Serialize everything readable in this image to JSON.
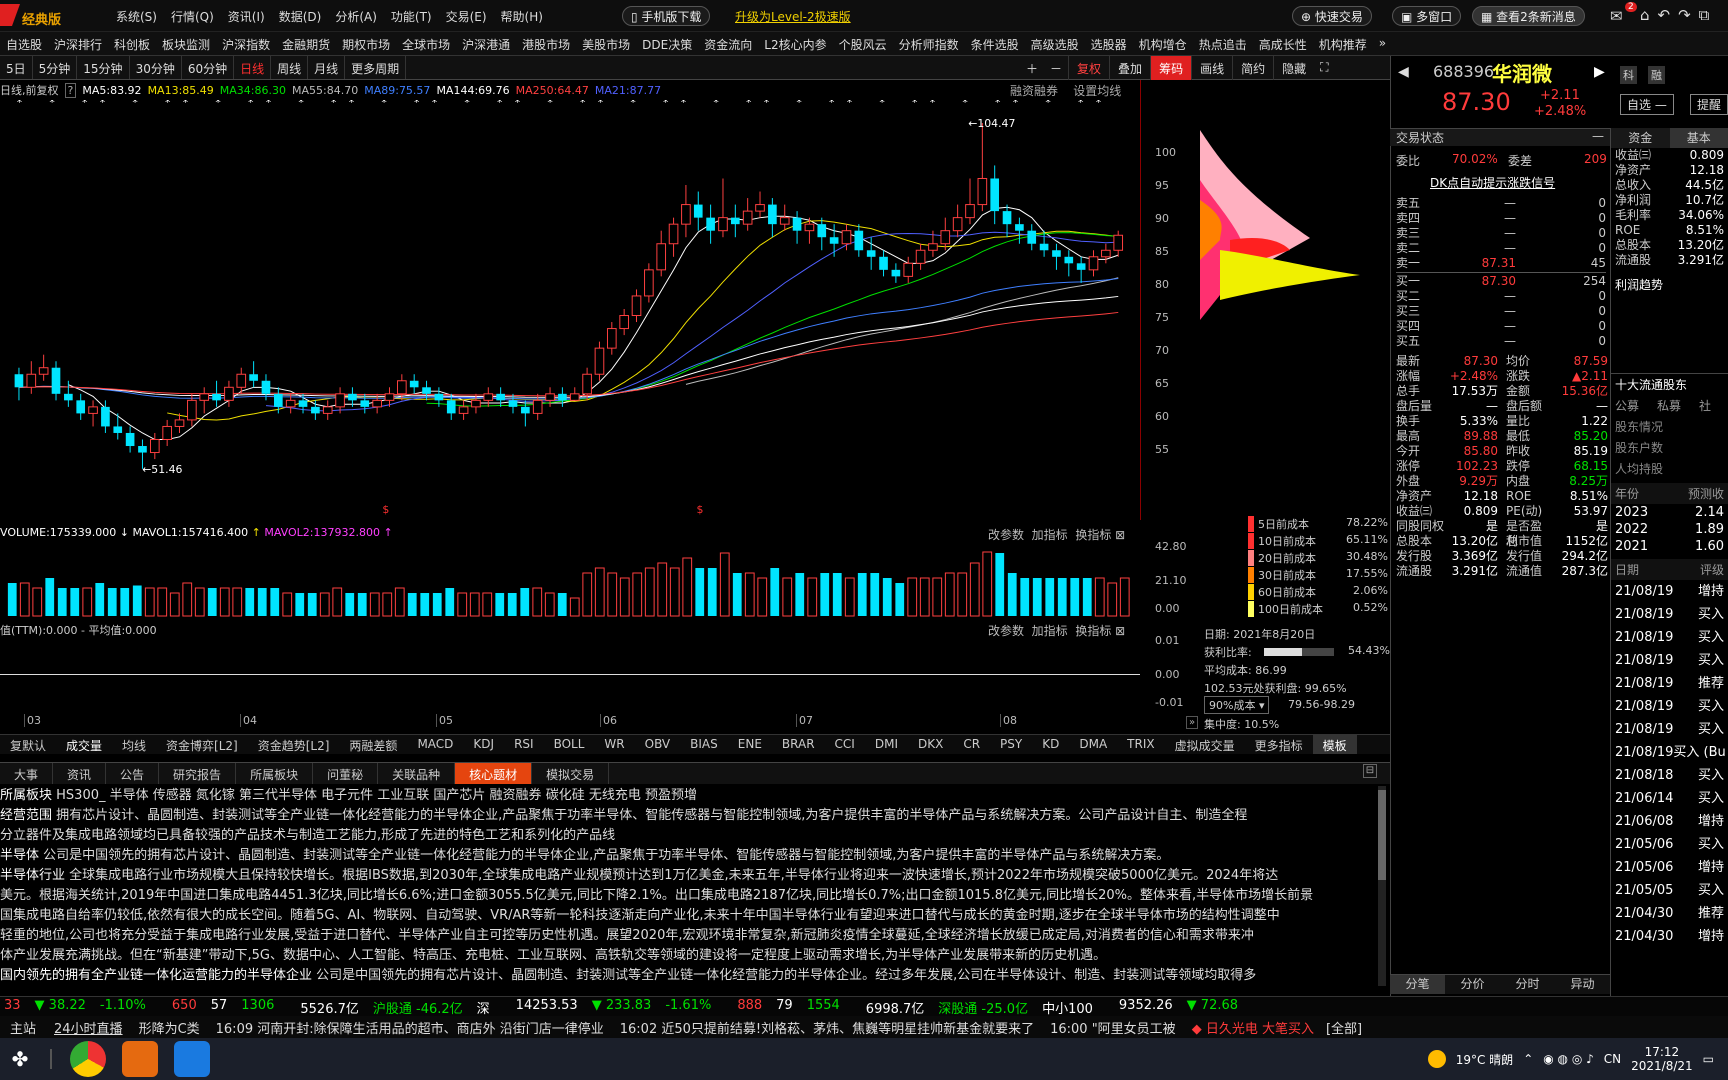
{
  "app": {
    "name": "经典版",
    "menu": [
      "系统(S)",
      "行情(Q)",
      "资讯(I)",
      "数据(D)",
      "分析(A)",
      "功能(T)",
      "交易(E)",
      "帮助(H)"
    ],
    "mobile_download": "手机版下载",
    "upgrade": "升级为Level-2极速版",
    "quick_trade": "快速交易",
    "multi_window": "多窗口",
    "news_alert": "查看2条新消息",
    "mail_badge": "2"
  },
  "nav": [
    "自选股",
    "沪深排行",
    "科创板",
    "板块监测",
    "沪深指数",
    "金融期货",
    "期权市场",
    "全球市场",
    "沪深港通",
    "港股市场",
    "美股市场",
    "DDE决策",
    "资金流向",
    "L2核心内参",
    "个股风云",
    "分析师指数",
    "条件选股",
    "高级选股",
    "选股器",
    "机构增仓",
    "热点追击",
    "高成长性",
    "机构推荐"
  ],
  "toolbar": {
    "periods": [
      "5日",
      "5分钟",
      "15分钟",
      "30分钟",
      "60分钟",
      "日线",
      "周线",
      "月线",
      "更多周期"
    ],
    "selected": "日线",
    "tools": [
      "复权",
      "叠加",
      "筹码",
      "画线",
      "简约",
      "隐藏"
    ]
  },
  "ma_legend": {
    "prefix": "日线,前复权",
    "items": [
      {
        "label": "MA5:83.92",
        "color": "#ffffff"
      },
      {
        "label": "MA13:85.49",
        "color": "#f0e000"
      },
      {
        "label": "MA34:86.30",
        "color": "#00e000"
      },
      {
        "label": "MA55:84.70",
        "color": "#bbbbbb"
      },
      {
        "label": "MA89:75.57",
        "color": "#3f7fff"
      },
      {
        "label": "MA144:69.76",
        "color": "#ffffff"
      },
      {
        "label": "MA250:64.47",
        "color": "#ff4040"
      },
      {
        "label": "MA21:87.77",
        "color": "#5060ff"
      }
    ],
    "right": [
      "融资融券",
      "设置均线"
    ]
  },
  "chart_data": {
    "type": "candlestick",
    "title": "688396 华润微 日线",
    "ylim": [
      52,
      105
    ],
    "y_ticks": [
      100,
      95,
      90,
      85,
      80,
      75,
      70,
      65,
      60,
      55
    ],
    "x_ticks": [
      "03",
      "04",
      "05",
      "06",
      "07",
      "08"
    ],
    "annotations": [
      {
        "label": "104.47"
      },
      {
        "label": "51.46"
      },
      {
        "label": "$"
      },
      {
        "label": "$"
      }
    ],
    "candles": [
      [
        66,
        64,
        67,
        62
      ],
      [
        64,
        66,
        68,
        63
      ],
      [
        66,
        67,
        69,
        65
      ],
      [
        67,
        63,
        68,
        62
      ],
      [
        63,
        62,
        65,
        61
      ],
      [
        62,
        60,
        63,
        59
      ],
      [
        60,
        61,
        62,
        58
      ],
      [
        61,
        58,
        62,
        57
      ],
      [
        58,
        57,
        60,
        56
      ],
      [
        57,
        55,
        58,
        54
      ],
      [
        55,
        54,
        56,
        51.5
      ],
      [
        54,
        56,
        57,
        53
      ],
      [
        56,
        58,
        59,
        55
      ],
      [
        58,
        59,
        60,
        57
      ],
      [
        59,
        62,
        63,
        58
      ],
      [
        62,
        63,
        64,
        60
      ],
      [
        63,
        62,
        65,
        61
      ],
      [
        62,
        64,
        65,
        61
      ],
      [
        64,
        66,
        67,
        63
      ],
      [
        66,
        65,
        68,
        64
      ],
      [
        65,
        63,
        66,
        62
      ],
      [
        63,
        61,
        64,
        60
      ],
      [
        61,
        62,
        63,
        60
      ],
      [
        62,
        61,
        63,
        60
      ],
      [
        61,
        60,
        62,
        59
      ],
      [
        60,
        61,
        62,
        59
      ],
      [
        61,
        63,
        64,
        60
      ],
      [
        63,
        62,
        64,
        61
      ],
      [
        62,
        61,
        63,
        60
      ],
      [
        61,
        62,
        63,
        60
      ],
      [
        62,
        63,
        64,
        61
      ],
      [
        63,
        65,
        66,
        62
      ],
      [
        65,
        64,
        66,
        63
      ],
      [
        64,
        63,
        65,
        62
      ],
      [
        63,
        62,
        64,
        61
      ],
      [
        62,
        60,
        63,
        59
      ],
      [
        60,
        61,
        62,
        59
      ],
      [
        61,
        62,
        63,
        60
      ],
      [
        62,
        63,
        64,
        61
      ],
      [
        63,
        62,
        64,
        61
      ],
      [
        62,
        61,
        63,
        60
      ],
      [
        61,
        60,
        62,
        58
      ],
      [
        60,
        62,
        63,
        59
      ],
      [
        62,
        63,
        64,
        61
      ],
      [
        63,
        62,
        64,
        61
      ],
      [
        62,
        63,
        64,
        62
      ],
      [
        63,
        66,
        67,
        62
      ],
      [
        66,
        70,
        71,
        65
      ],
      [
        70,
        73,
        74,
        69
      ],
      [
        73,
        75,
        76,
        72
      ],
      [
        75,
        78,
        79,
        74
      ],
      [
        78,
        82,
        83,
        77
      ],
      [
        82,
        86,
        88,
        81
      ],
      [
        86,
        89,
        90,
        84
      ],
      [
        89,
        92,
        95,
        87
      ],
      [
        92,
        90,
        94,
        88
      ],
      [
        90,
        88,
        92,
        86
      ],
      [
        88,
        90,
        96,
        87
      ],
      [
        90,
        89,
        92,
        87
      ],
      [
        89,
        91,
        93,
        88
      ],
      [
        91,
        92,
        94,
        90
      ],
      [
        92,
        89,
        93,
        87
      ],
      [
        89,
        90,
        92,
        88
      ],
      [
        90,
        88,
        91,
        86
      ],
      [
        88,
        89,
        90,
        86
      ],
      [
        89,
        87,
        90,
        85
      ],
      [
        87,
        86,
        89,
        84
      ],
      [
        86,
        88,
        89,
        85
      ],
      [
        88,
        85,
        89,
        84
      ],
      [
        85,
        84,
        87,
        82
      ],
      [
        84,
        82,
        85,
        81
      ],
      [
        82,
        81,
        83,
        80
      ],
      [
        81,
        83,
        84,
        80
      ],
      [
        83,
        85,
        86,
        82
      ],
      [
        85,
        86,
        88,
        84
      ],
      [
        86,
        88,
        90,
        85
      ],
      [
        88,
        90,
        92,
        87
      ],
      [
        90,
        92,
        96,
        89
      ],
      [
        92,
        96,
        104.5,
        91
      ],
      [
        96,
        91,
        98,
        89
      ],
      [
        91,
        89,
        92,
        87
      ],
      [
        89,
        88,
        90,
        86
      ],
      [
        88,
        86,
        89,
        85
      ],
      [
        86,
        85,
        88,
        84
      ],
      [
        85,
        84,
        86,
        82
      ],
      [
        84,
        83,
        85,
        81
      ],
      [
        83,
        82,
        84,
        80
      ],
      [
        82,
        84,
        85,
        81
      ],
      [
        84,
        85,
        86,
        83
      ],
      [
        85,
        87.3,
        88,
        84
      ]
    ]
  },
  "volume": {
    "label": "VOLUME:175339.000",
    "mavol1": "MAVOL1:157416.400",
    "mavol2": "MAVOL2:137932.800",
    "ticks": [
      "42.80",
      "21.10",
      "0.00"
    ],
    "tools": [
      "改参数",
      "加指标",
      "换指标"
    ]
  },
  "ttm": {
    "label": "值(TTM):0.000 - 平均值:0.000",
    "ticks": [
      "0.01",
      "0.00",
      "-0.01"
    ],
    "tools": [
      "改参数",
      "加指标",
      "换指标"
    ]
  },
  "chips": {
    "rows": [
      {
        "label": "5日前成本",
        "value": "78.22%",
        "color": "#ff3030"
      },
      {
        "label": "10日前成本",
        "value": "65.11%",
        "color": "#ff3030"
      },
      {
        "label": "20日前成本",
        "value": "30.48%",
        "color": "#ff8080"
      },
      {
        "label": "30日前成本",
        "value": "17.55%",
        "color": "#ff8000"
      },
      {
        "label": "60日前成本",
        "value": "2.06%",
        "color": "#ffd000"
      },
      {
        "label": "100日前成本",
        "value": "0.52%",
        "color": "#ffff60"
      }
    ],
    "date": "日期: 2021年8月20日",
    "profit_label": "获利比率:",
    "profit": "54.43%",
    "avg_cost": "平均成本: 86.99",
    "profit_cost": "102.53元处获利盘: 99.65%",
    "cost90": "90%成本",
    "cost90_range": "79.56-98.29",
    "concentration": "集中度: 10.5%"
  },
  "indicators": [
    "复默认",
    "成交量",
    "均线",
    "资金博弈[L2]",
    "资金趋势[L2]",
    "两融差额",
    "MACD",
    "KDJ",
    "RSI",
    "BOLL",
    "WR",
    "OBV",
    "BIAS",
    "ENE",
    "BRAR",
    "CCI",
    "DMI",
    "DKX",
    "CR",
    "PSY",
    "KD",
    "DMA",
    "TRIX",
    "虚拟成交量",
    "更多指标",
    "模板"
  ],
  "tabs": [
    "大事",
    "资讯",
    "公告",
    "研究报告",
    "所属板块",
    "问董秘",
    "关联品种",
    "核心题材",
    "模拟交易"
  ],
  "tab_selected": "核心题材",
  "content": [
    {
      "head": "所属板块",
      "text": "HS300_ 半导体 传感器 氮化镓 第三代半导体 电子元件 工业互联 国产芯片 融资融券 碳化硅 无线充电 预盈预增"
    },
    {
      "head": "经营范围",
      "text": "拥有芯片设计、晶圆制造、封装测试等全产业链一体化经营能力的半导体企业,产品聚焦于功率半导体、智能传感器与智能控制领域,为客户提供丰富的半导体产品与系统解决方案。公司产品设计自主、制造全程"
    },
    {
      "head": "",
      "text": "分立器件及集成电路领域均已具备较强的产品技术与制造工艺能力,形成了先进的特色工艺和系列化的产品线"
    },
    {
      "head": "半导体",
      "text": "公司是中国领先的拥有芯片设计、晶圆制造、封装测试等全产业链一体化经营能力的半导体企业,产品聚焦于功率半导体、智能传感器与智能控制领域,为客户提供丰富的半导体产品与系统解决方案。"
    },
    {
      "head": "半导体行业",
      "text": "全球集成电路行业市场规模大且保持较快增长。根据IBS数据,到2030年,全球集成电路产业规模预计达到1万亿美金,未来五年,半导体行业将迎来一波快速增长,预计2022年市场规模突破5000亿美元。2024年将达"
    },
    {
      "head": "",
      "text": "美元。根据海关统计,2019年中国进口集成电路4451.3亿块,同比增长6.6%;进口金额3055.5亿美元,同比下降2.1%。出口集成电路2187亿块,同比增长0.7%;出口金额1015.8亿美元,同比增长20%。整体来看,半导体市场增长前景"
    },
    {
      "head": "",
      "text": "国集成电路自给率仍较低,依然有很大的成长空间。随着5G、AI、物联网、自动驾驶、VR/AR等新一轮科技逐渐走向产业化,未来十年中国半导体行业有望迎来进口替代与成长的黄金时期,逐步在全球半导体市场的结构性调整中"
    },
    {
      "head": "",
      "text": "轻重的地位,公司也将充分受益于集成电路行业发展,受益于进口替代、半导体产业自主可控等历史性机遇。展望2020年,宏观环境非常复杂,新冠肺炎疫情全球蔓延,全球经济增长放缓已成定局,对消费者的信心和需求带来冲"
    },
    {
      "head": "",
      "text": "体产业发展充满挑战。但在“新基建”带动下,5G、数据中心、人工智能、特高压、充电桩、工业互联网、高铁轨交等领域的建设将一定程度上驱动需求增长,为半导体产业发展带来新的历史机遇。"
    },
    {
      "head": "国内领先的拥有全产业链一体化运营能力的半导体企业",
      "text": "公司是中国领先的拥有芯片设计、晶圆制造、封装测试等全产业链一体化经营能力的半导体企业。经过多年发展,公司在半导体设计、制造、封装测试等领域均取得多"
    }
  ],
  "quote": {
    "code": "688396",
    "name": "华润微",
    "price": "87.30",
    "change": "+2.11",
    "pct": "+2.48%",
    "btn_watch": "自选",
    "btn_alert": "提醒",
    "tags": [
      "科",
      "融"
    ]
  },
  "trade_status": {
    "label": "交易状态",
    "wb_label": "委比",
    "wb": "70.02%",
    "wc_label": "委差",
    "wc": "209",
    "dk": "DK点自动提示涨跌信号"
  },
  "orderbook": {
    "sell": [
      [
        "卖五",
        "—",
        "0"
      ],
      [
        "卖四",
        "—",
        "0"
      ],
      [
        "卖三",
        "—",
        "0"
      ],
      [
        "卖二",
        "—",
        "0"
      ],
      [
        "卖一",
        "87.31",
        "45"
      ]
    ],
    "buy": [
      [
        "买一",
        "87.30",
        "254"
      ],
      [
        "买二",
        "—",
        "0"
      ],
      [
        "买三",
        "—",
        "0"
      ],
      [
        "买四",
        "—",
        "0"
      ],
      [
        "买五",
        "—",
        "0"
      ]
    ]
  },
  "stats": [
    [
      "最新",
      "87.30",
      "均价",
      "87.59"
    ],
    [
      "涨幅",
      "+2.48%",
      "涨跌",
      "▲2.11"
    ],
    [
      "总手",
      "17.53万",
      "金额",
      "15.36亿"
    ],
    [
      "盘后量",
      "—",
      "盘后额",
      "—"
    ],
    [
      "换手",
      "5.33%",
      "量比",
      "1.22"
    ],
    [
      "最高",
      "89.88",
      "最低",
      "85.20"
    ],
    [
      "今开",
      "85.80",
      "昨收",
      "85.19"
    ],
    [
      "涨停",
      "102.23",
      "跌停",
      "68.15"
    ],
    [
      "外盘",
      "9.29万",
      "内盘",
      "8.25万"
    ],
    [
      "净资产",
      "12.18",
      "ROE",
      "8.51%"
    ],
    [
      "收益㈢",
      "0.809",
      "PE(动)",
      "53.97"
    ],
    [
      "同股同权",
      "是",
      "是否盈利",
      "是"
    ],
    [
      "总股本",
      "13.20亿",
      "总市值",
      "1152亿"
    ],
    [
      "发行股",
      "3.369亿",
      "发行值",
      "294.2亿"
    ],
    [
      "流通股",
      "3.291亿",
      "流通值",
      "287.3亿"
    ]
  ],
  "bottom_tabs": [
    "分笔",
    "分价",
    "分时",
    "异动"
  ],
  "fin": {
    "tabs": [
      "资金",
      "基本"
    ],
    "rows": [
      [
        "收益㈢",
        "0.809"
      ],
      [
        "净资产",
        "12.18"
      ],
      [
        "总收入",
        "44.5亿"
      ],
      [
        "净利润",
        "10.7亿"
      ],
      [
        "毛利率",
        "34.06%"
      ],
      [
        "ROE",
        "8.51%"
      ],
      [
        "总股本",
        "13.20亿"
      ],
      [
        "流通股",
        "3.291亿"
      ]
    ],
    "trend": "利润趋势",
    "holders": "十大流通股东",
    "holder_tabs": [
      "公募",
      "私募",
      "社"
    ],
    "links": [
      "股东情况",
      "股东户数",
      "人均持股"
    ],
    "year_head": [
      "年份",
      "预测收"
    ],
    "years": [
      [
        "2023",
        "2.14"
      ],
      [
        "2022",
        "1.89"
      ],
      [
        "2021",
        "1.60"
      ]
    ],
    "date_head": [
      "日期",
      "评级"
    ],
    "ratings": [
      [
        "21/08/19",
        "增持"
      ],
      [
        "21/08/19",
        "买入"
      ],
      [
        "21/08/19",
        "买入"
      ],
      [
        "21/08/19",
        "买入"
      ],
      [
        "21/08/19",
        "推荐"
      ],
      [
        "21/08/19",
        "买入"
      ],
      [
        "21/08/19",
        "买入"
      ],
      [
        "21/08/19",
        "买入 (Bu"
      ],
      [
        "21/08/18",
        "买入"
      ],
      [
        "21/06/14",
        "买入"
      ],
      [
        "21/06/08",
        "增持"
      ],
      [
        "21/05/06",
        "买入"
      ],
      [
        "21/05/06",
        "增持"
      ],
      [
        "21/05/05",
        "买入"
      ],
      [
        "21/04/30",
        "推荐"
      ],
      [
        "21/04/30",
        "增持"
      ]
    ]
  },
  "ticker": [
    {
      "t": "33",
      "c": "#ff3b3b"
    },
    {
      "t": "▼ 38.22",
      "c": "#00e000"
    },
    {
      "t": "-1.10%",
      "c": "#00e000"
    },
    {
      "t": "650",
      "c": "#ff3b3b"
    },
    {
      "t": "57",
      "c": "#fff"
    },
    {
      "t": "1306",
      "c": "#00e000"
    },
    {
      "t": "5526.7亿",
      "c": "#fff"
    },
    {
      "t": "沪股通 -46.2亿",
      "c": "#00e000"
    },
    {
      "t": "深",
      "c": "#fff"
    },
    {
      "t": "14253.53",
      "c": "#fff"
    },
    {
      "t": "▼ 233.83",
      "c": "#00e000"
    },
    {
      "t": "-1.61%",
      "c": "#00e000"
    },
    {
      "t": "888",
      "c": "#ff3b3b"
    },
    {
      "t": "79",
      "c": "#fff"
    },
    {
      "t": "1554",
      "c": "#00e000"
    },
    {
      "t": "6998.7亿",
      "c": "#fff"
    },
    {
      "t": "深股通 -25.0亿",
      "c": "#00e000"
    },
    {
      "t": "中小100",
      "c": "#fff"
    },
    {
      "t": "9352.26",
      "c": "#fff"
    },
    {
      "t": "▼ 72.68",
      "c": "#00e000"
    }
  ],
  "news": {
    "left": "主站",
    "live": "24小时直播",
    "items": [
      "形降为C类",
      "16:09 河南开封:除保障生活用品的超市、商店外 沿街门店一律停业",
      "16:02 近50只提前结募!刘格菘、茅炜、焦巍等明星挂帅新基金就要来了",
      "16:00 \"阿里女员工被"
    ],
    "right": "◆ 日久光电 大笔买入",
    "all": "[全部]"
  },
  "taskbar": {
    "weather": "19°C 晴朗",
    "lang": "CN",
    "time": "17:12",
    "date": "2021/8/21"
  }
}
